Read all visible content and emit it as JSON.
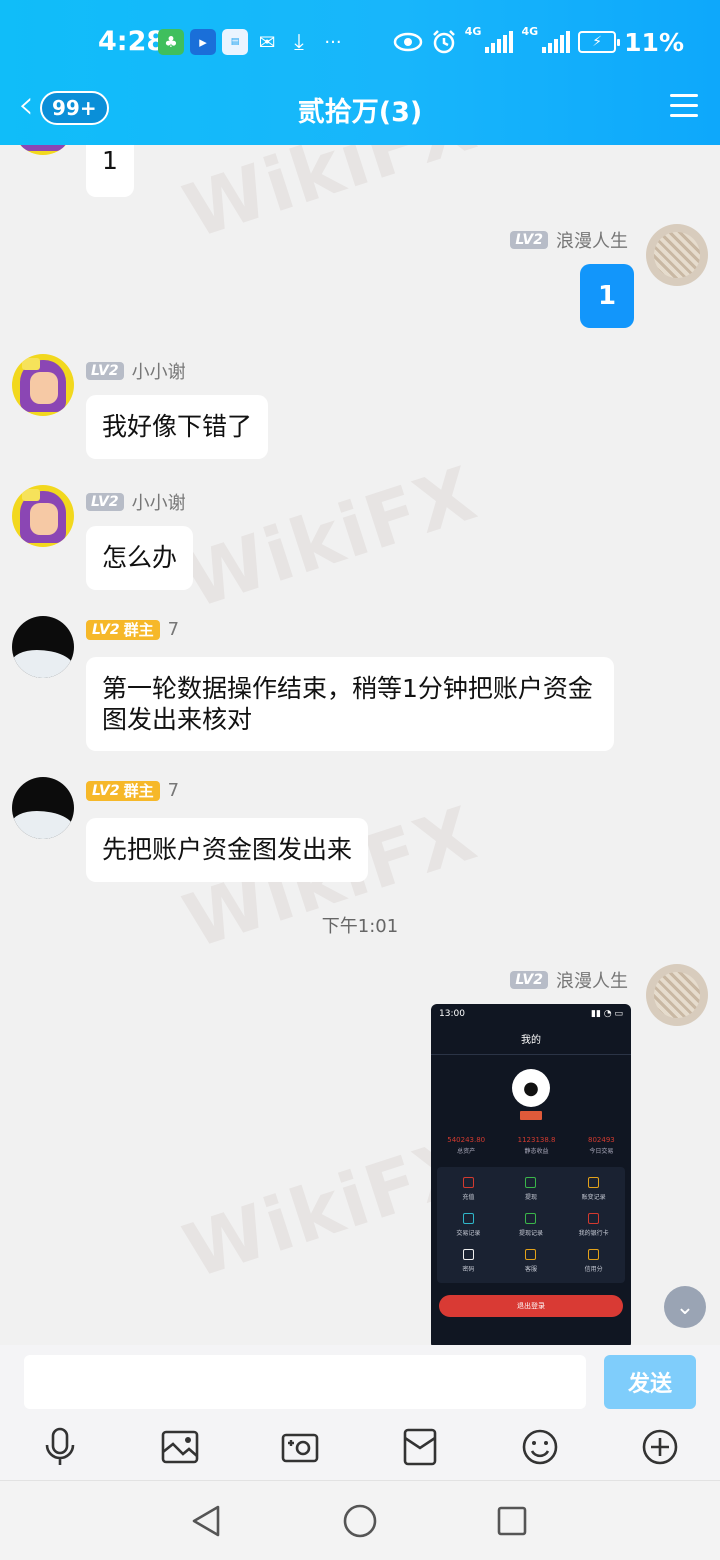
{
  "status_bar": {
    "time": "4:28",
    "network_1": "4G",
    "network_2": "4G",
    "battery_percent": "11%",
    "more_indicator": "···"
  },
  "header": {
    "back_badge": "99+",
    "title": "贰拾万(3)",
    "colors": {
      "bar": "#18b6fb",
      "self_bubble": "#1296fb"
    }
  },
  "watermark": "WikiFX",
  "messages": [
    {
      "sender": "",
      "text": "1",
      "side": "left",
      "partial": true
    },
    {
      "sender": "浪漫人生",
      "level": "LV2",
      "text": "1",
      "side": "right"
    },
    {
      "sender": "小小谢",
      "level": "LV2",
      "text": "我好像下错了",
      "side": "left"
    },
    {
      "sender": "小小谢",
      "level": "LV2",
      "text": "怎么办",
      "side": "left"
    },
    {
      "sender": "7",
      "level": "LV2",
      "role": "群主",
      "text": "第一轮数据操作结束，稍等1分钟把账户资金图发出来核对",
      "side": "left"
    },
    {
      "sender": "7",
      "level": "LV2",
      "role": "群主",
      "text": "先把账户资金图发出来",
      "side": "left"
    }
  ],
  "time_separator": "下午1:01",
  "image_message": {
    "sender": "浪漫人生",
    "level": "LV2",
    "screenshot": {
      "time": "13:00",
      "title": "我的",
      "stats": [
        {
          "value": "540243.80",
          "label": "总资产"
        },
        {
          "value": "1123138.8",
          "label": "静态收益"
        },
        {
          "value": "802493",
          "label": "今日交易"
        }
      ],
      "grid": [
        {
          "label": "充值",
          "color": "#d23a2f"
        },
        {
          "label": "提现",
          "color": "#3bb54a"
        },
        {
          "label": "账变记录",
          "color": "#e3a21a"
        },
        {
          "label": "交易记录",
          "color": "#2fb6c9"
        },
        {
          "label": "提现记录",
          "color": "#3bb54a"
        },
        {
          "label": "我的银行卡",
          "color": "#d23a2f"
        },
        {
          "label": "密码",
          "color": "#eeeeee"
        },
        {
          "label": "客服",
          "color": "#e3a21a"
        },
        {
          "label": "信用分",
          "color": "#e3a21a"
        }
      ],
      "logout": "退出登录"
    }
  },
  "input": {
    "value": "",
    "send_label": "发送"
  },
  "toolbar_icons": [
    "microphone-icon",
    "image-icon",
    "camera-icon",
    "red-packet-icon",
    "emoji-icon",
    "plus-icon"
  ]
}
